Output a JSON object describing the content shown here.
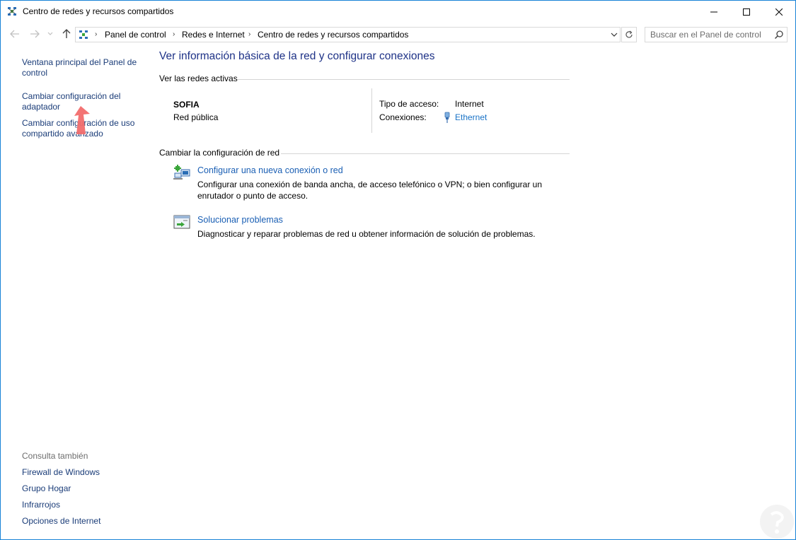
{
  "window": {
    "title": "Centro de redes y recursos compartidos"
  },
  "nav": {
    "breadcrumbs": [
      "Panel de control",
      "Redes e Internet",
      "Centro de redes y recursos compartidos"
    ],
    "search_placeholder": "Buscar en el Panel de control"
  },
  "left": {
    "links": [
      "Ventana principal del Panel de control",
      "Cambiar configuración del adaptador",
      "Cambiar configuración de uso compartido avanzado"
    ],
    "see_also_heading": "Consulta también",
    "see_also": [
      "Firewall de Windows",
      "Grupo Hogar",
      "Infrarrojos",
      "Opciones de Internet"
    ]
  },
  "main": {
    "title": "Ver información básica de la red y configurar conexiones",
    "active_networks_header": "Ver las redes activas",
    "network": {
      "name": "SOFIA",
      "category": "Red pública",
      "access_type_label": "Tipo de acceso:",
      "access_type_value": "Internet",
      "connections_label": "Conexiones:",
      "connection_name": "Ethernet"
    },
    "change_settings_header": "Cambiar la configuración de red",
    "tasks": [
      {
        "title": "Configurar una nueva conexión o red",
        "description": "Configurar una conexión de banda ancha, de acceso telefónico o VPN; o bien configurar un enrutador o punto de acceso.",
        "icon": "network-setup-icon"
      },
      {
        "title": "Solucionar problemas",
        "description": "Diagnosticar y reparar problemas de red u obtener información de solución de problemas.",
        "icon": "troubleshoot-icon"
      }
    ]
  },
  "colors": {
    "link": "#1a5fb4",
    "nav_link": "#1a3c78",
    "title": "#1e3287",
    "pointer_arrow": "#f26d6d"
  }
}
